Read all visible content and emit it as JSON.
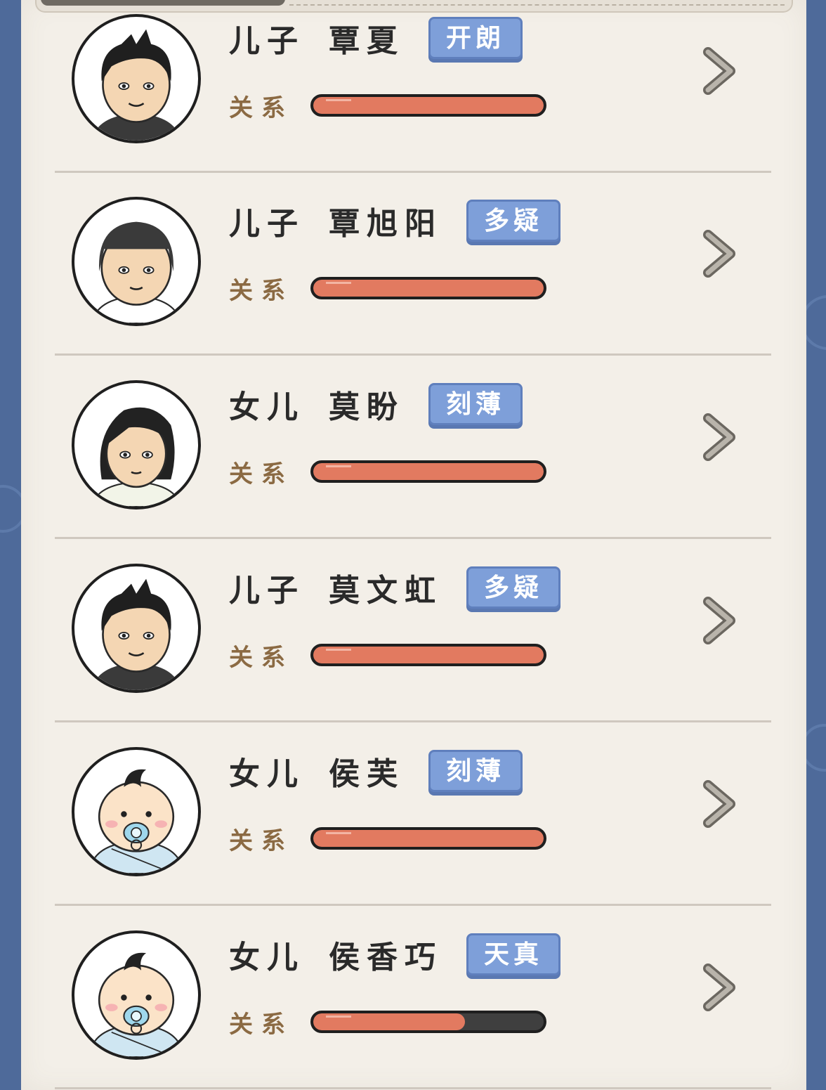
{
  "rows": [
    {
      "relation": "儿子",
      "name": "覃夏",
      "tag": "开朗",
      "relation_label": "关系",
      "relationship_level": 1.0,
      "avatar": "adult-male-spiky-hair"
    },
    {
      "relation": "儿子",
      "name": "覃旭阳",
      "tag": "多疑",
      "relation_label": "关系",
      "relationship_level": 1.0,
      "avatar": "adult-male-bowl-cut"
    },
    {
      "relation": "女儿",
      "name": "莫盼",
      "tag": "刻薄",
      "relation_label": "关系",
      "relationship_level": 1.0,
      "avatar": "adult-female-short-hair"
    },
    {
      "relation": "儿子",
      "name": "莫文虹",
      "tag": "多疑",
      "relation_label": "关系",
      "relationship_level": 1.0,
      "avatar": "adult-male-spiky-hair"
    },
    {
      "relation": "女儿",
      "name": "侯芙",
      "tag": "刻薄",
      "relation_label": "关系",
      "relationship_level": 1.0,
      "avatar": "baby-with-pacifier"
    },
    {
      "relation": "女儿",
      "name": "侯香巧",
      "tag": "天真",
      "relation_label": "关系",
      "relationship_level": 0.66,
      "avatar": "baby-with-pacifier"
    }
  ],
  "colors": {
    "tag_bg": "#7e9fd9",
    "bar_fill": "#e27a60",
    "bar_empty": "#3f3f3f",
    "paper": "#f3efe8",
    "frame": "#4e6a9a"
  }
}
